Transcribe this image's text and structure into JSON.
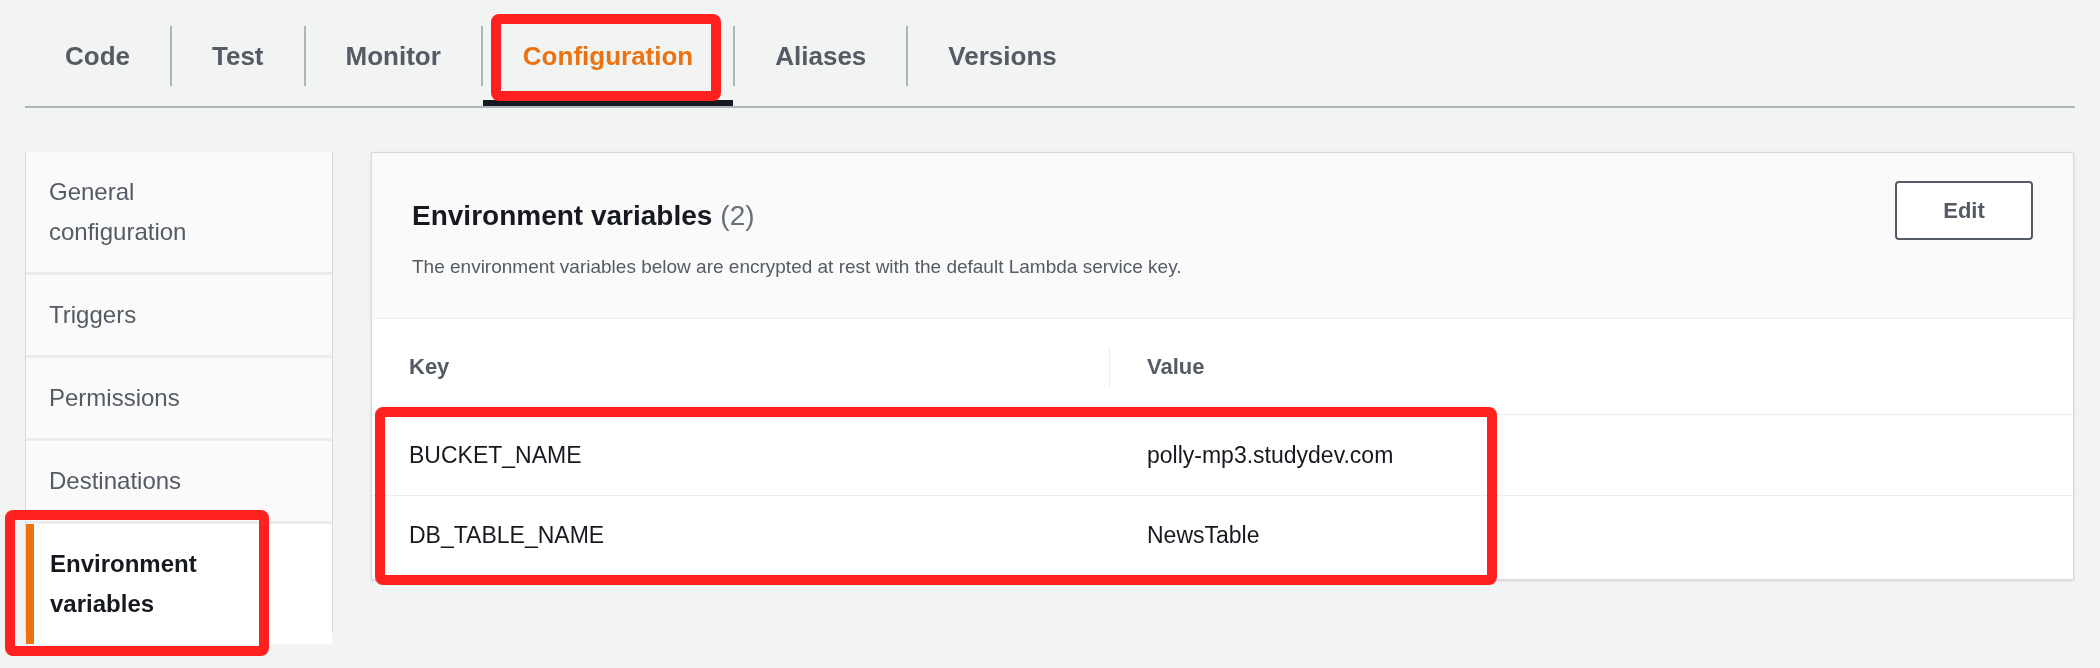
{
  "tabs": [
    {
      "label": "Code",
      "selected": false,
      "highlighted": false
    },
    {
      "label": "Test",
      "selected": false,
      "highlighted": false
    },
    {
      "label": "Monitor",
      "selected": false,
      "highlighted": false
    },
    {
      "label": "Configuration",
      "selected": true,
      "highlighted": true
    },
    {
      "label": "Aliases",
      "selected": false,
      "highlighted": false
    },
    {
      "label": "Versions",
      "selected": false,
      "highlighted": false
    }
  ],
  "sidebar": {
    "items": [
      {
        "label": "General configuration",
        "selected": false,
        "highlighted": false
      },
      {
        "label": "Triggers",
        "selected": false,
        "highlighted": false
      },
      {
        "label": "Permissions",
        "selected": false,
        "highlighted": false
      },
      {
        "label": "Destinations",
        "selected": false,
        "highlighted": false
      },
      {
        "label": "Environment variables",
        "selected": true,
        "highlighted": true
      }
    ]
  },
  "panel": {
    "title": "Environment variables",
    "count": "(2)",
    "description": "The environment variables below are encrypted at rest with the default Lambda service key.",
    "edit_button": "Edit",
    "table": {
      "columns": [
        "Key",
        "Value"
      ],
      "rows_highlighted": true,
      "rows": [
        [
          "BUCKET_NAME",
          "polly-mp3.studydev.com"
        ],
        [
          "DB_TABLE_NAME",
          "NewsTable"
        ]
      ]
    }
  }
}
